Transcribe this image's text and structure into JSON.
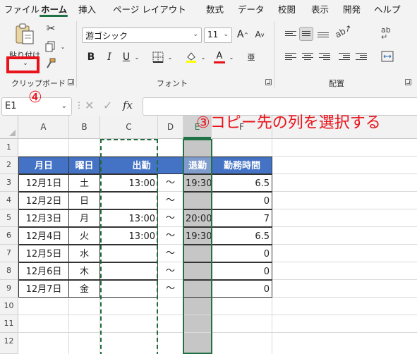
{
  "menu": {
    "tabs": [
      "ファイル",
      "ホーム",
      "挿入",
      "ページ レイアウト",
      "数式",
      "データ",
      "校閲",
      "表示",
      "開発",
      "ヘルプ"
    ],
    "active": "ホーム"
  },
  "ribbon": {
    "clipboard": {
      "paste_label": "貼り付け",
      "group_label": "クリップボード",
      "icons": [
        "paste-icon",
        "cut-icon",
        "copy-icon",
        "format-painter-icon"
      ]
    },
    "font": {
      "font_name": "游ゴシック",
      "font_size": "11",
      "group_label": "フォント",
      "buttons": [
        "B",
        "I",
        "U"
      ]
    },
    "alignment": {
      "group_label": "配置"
    }
  },
  "formula_bar": {
    "name_box": "E1",
    "fx": "fx",
    "value": ""
  },
  "annotations": {
    "step3": "③コピー先の列を選択する",
    "step4": "④"
  },
  "grid": {
    "columns": [
      "A",
      "B",
      "C",
      "D",
      "E",
      "F"
    ],
    "rows": [
      "1",
      "2",
      "3",
      "4",
      "5",
      "6",
      "7",
      "8",
      "9",
      "10",
      "11",
      "12"
    ],
    "header_row": {
      "a": "月日",
      "b": "曜日",
      "c": "出勤",
      "e": "退勤",
      "f": "勤務時間"
    },
    "data_rows": [
      {
        "a": "12月1日",
        "b": "土",
        "c": "13:00",
        "d": "～",
        "e": "19:30",
        "f": "6.5"
      },
      {
        "a": "12月2日",
        "b": "日",
        "c": "",
        "d": "～",
        "e": "",
        "f": "0"
      },
      {
        "a": "12月3日",
        "b": "月",
        "c": "13:00",
        "d": "～",
        "e": "20:00",
        "f": "7"
      },
      {
        "a": "12月4日",
        "b": "火",
        "c": "13:00",
        "d": "～",
        "e": "19:30",
        "f": "6.5"
      },
      {
        "a": "12月5日",
        "b": "水",
        "c": "",
        "d": "～",
        "e": "",
        "f": "0"
      },
      {
        "a": "12月6日",
        "b": "木",
        "c": "",
        "d": "～",
        "e": "",
        "f": "0"
      },
      {
        "a": "12月7日",
        "b": "金",
        "c": "",
        "d": "～",
        "e": "",
        "f": "0"
      }
    ]
  },
  "colors": {
    "header_fill": "#4472c4",
    "selection": "#217346",
    "annotation": "#e8121b"
  }
}
